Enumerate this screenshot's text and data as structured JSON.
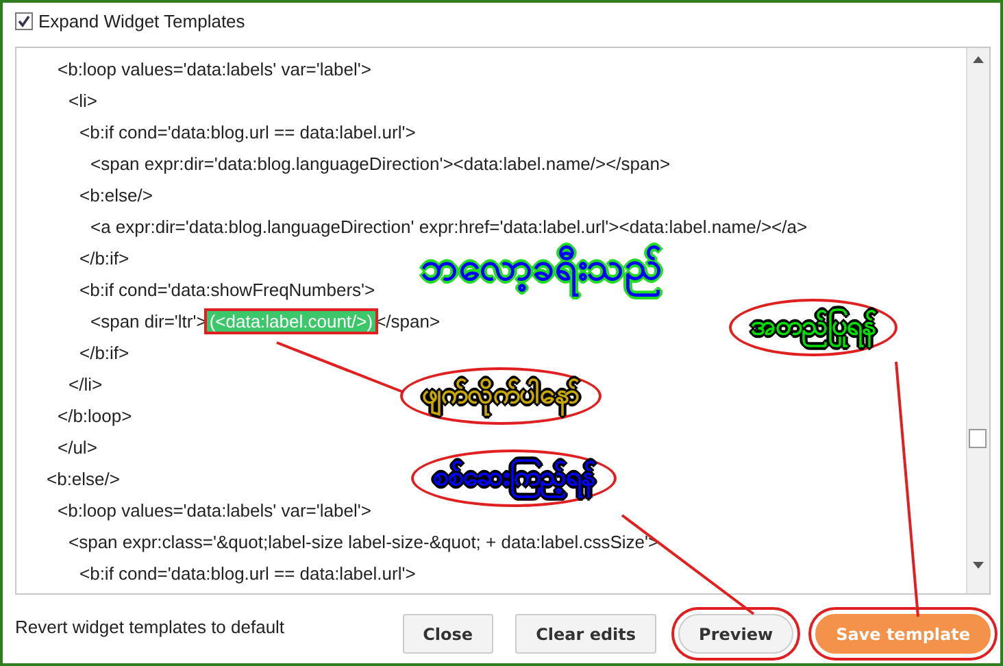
{
  "expand_checkbox": {
    "label": "Expand Widget Templates",
    "checked": true
  },
  "code_lines": [
    {
      "children": [
        {
          "text": "<b:loop values='data:labels' var='label'>",
          "children": [
            {
              "text": "<li>",
              "children": [
                {
                  "text": "<b:if cond='data:blog.url == data:label.url'>",
                  "children": [
                    {
                      "text": "<span expr:dir='data:blog.languageDirection'><data:label.name/></span>"
                    }
                  ]
                },
                {
                  "text": "<b:else/>",
                  "children": [
                    {
                      "text": "<a expr:dir='data:blog.languageDirection' expr:href='data:label.url'><data:label.name/></a>"
                    }
                  ]
                },
                {
                  "text": "</b:if>"
                },
                {
                  "text": "<b:if cond='data:showFreqNumbers'>",
                  "children": [
                    {
                      "text": "<span dir='ltr'>",
                      "highlight": "(<data:label.count/>)",
                      "after": "</span>"
                    }
                  ]
                },
                {
                  "text": "</b:if>"
                }
              ]
            },
            {
              "text": "</li>"
            }
          ]
        },
        {
          "text": "</b:loop>"
        },
        {
          "text": "</ul>"
        }
      ]
    },
    {
      "text": "<b:else/>",
      "children": [
        {
          "text": "<b:loop values='data:labels' var='label'>",
          "children": [
            {
              "text": "<span expr:class='&quot;label-size label-size-&quot; + data:label.cssSize'>",
              "children": [
                {
                  "text": "<b:if cond='data:blog.url == data:label.url'>"
                }
              ]
            }
          ]
        }
      ]
    }
  ],
  "revert_link": "Revert widget templates to default",
  "buttons": [
    {
      "label": "Close",
      "kind": "plain",
      "circled": false
    },
    {
      "label": "Clear edits",
      "kind": "plain",
      "circled": false
    },
    {
      "label": "Preview",
      "kind": "plain",
      "circled": true
    },
    {
      "label": "Save template",
      "kind": "primary",
      "circled": true
    }
  ],
  "overlay_title": {
    "text": "ဘလော့ခရီးသည်",
    "color": "#0000ff"
  },
  "annotations": [
    {
      "text": "အတည်ပြုရန်",
      "color": "#00dd00"
    },
    {
      "text": "ဖျက်လိုက်ပါနော်",
      "color": "#c8a800"
    },
    {
      "text": "စစ်ဆေးကြည့်ရန်",
      "color": "#0000ff"
    }
  ]
}
